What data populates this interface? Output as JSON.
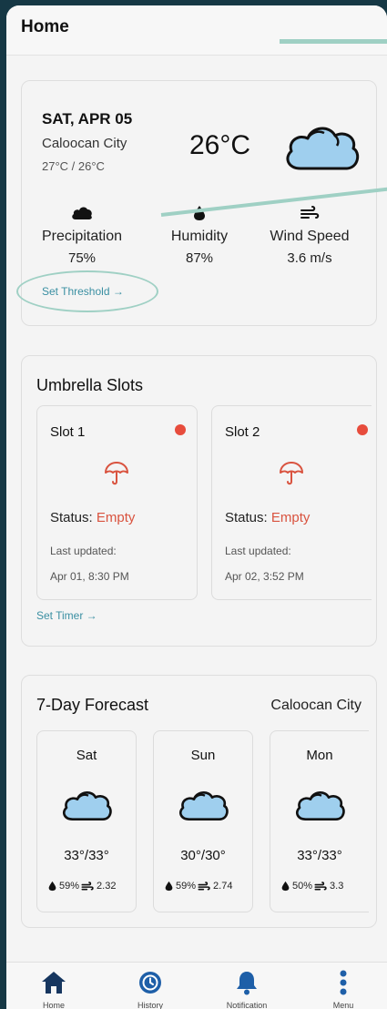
{
  "header": {
    "title": "Home"
  },
  "current": {
    "date": "SAT, APR 05",
    "city": "Caloocan City",
    "range": "27°C / 26°C",
    "temp": "26°C",
    "icon": "cloud-icon",
    "stats": [
      {
        "label": "Precipitation",
        "value": "75%",
        "icon": "cloud-icon"
      },
      {
        "label": "Humidity",
        "value": "87%",
        "icon": "droplet-icon"
      },
      {
        "label": "Wind Speed",
        "value": "3.6 m/s",
        "icon": "wind-icon"
      }
    ],
    "threshold_link": "Set Threshold →"
  },
  "slots": {
    "title": "Umbrella Slots",
    "status_label": "Status:",
    "updated_label": "Last updated:",
    "items": [
      {
        "name": "Slot 1",
        "status": "Empty",
        "updated": "Apr 01, 8:30 PM"
      },
      {
        "name": "Slot 2",
        "status": "Empty",
        "updated": "Apr 02, 3:52 PM"
      }
    ],
    "timer_link": "Set Timer →"
  },
  "forecast": {
    "title": "7-Day Forecast",
    "city": "Caloocan City",
    "days": [
      {
        "day": "Sat",
        "temp": "33°/33°",
        "humidity": "59%",
        "wind": "2.32"
      },
      {
        "day": "Sun",
        "temp": "30°/30°",
        "humidity": "59%",
        "wind": "2.74"
      },
      {
        "day": "Mon",
        "temp": "33°/33°",
        "humidity": "50%",
        "wind": "3.3"
      }
    ]
  },
  "nav": [
    {
      "label": "Home",
      "icon": "home-icon"
    },
    {
      "label": "History",
      "icon": "history-icon"
    },
    {
      "label": "Notification",
      "icon": "bell-icon"
    },
    {
      "label": "Menu",
      "icon": "menu-dots-icon"
    }
  ],
  "colors": {
    "accent": "#3a8fa2",
    "highlight": "#9fd0c4",
    "alert": "#e74c3c",
    "cloud": "#9fcfee",
    "nav": "#16365f"
  }
}
